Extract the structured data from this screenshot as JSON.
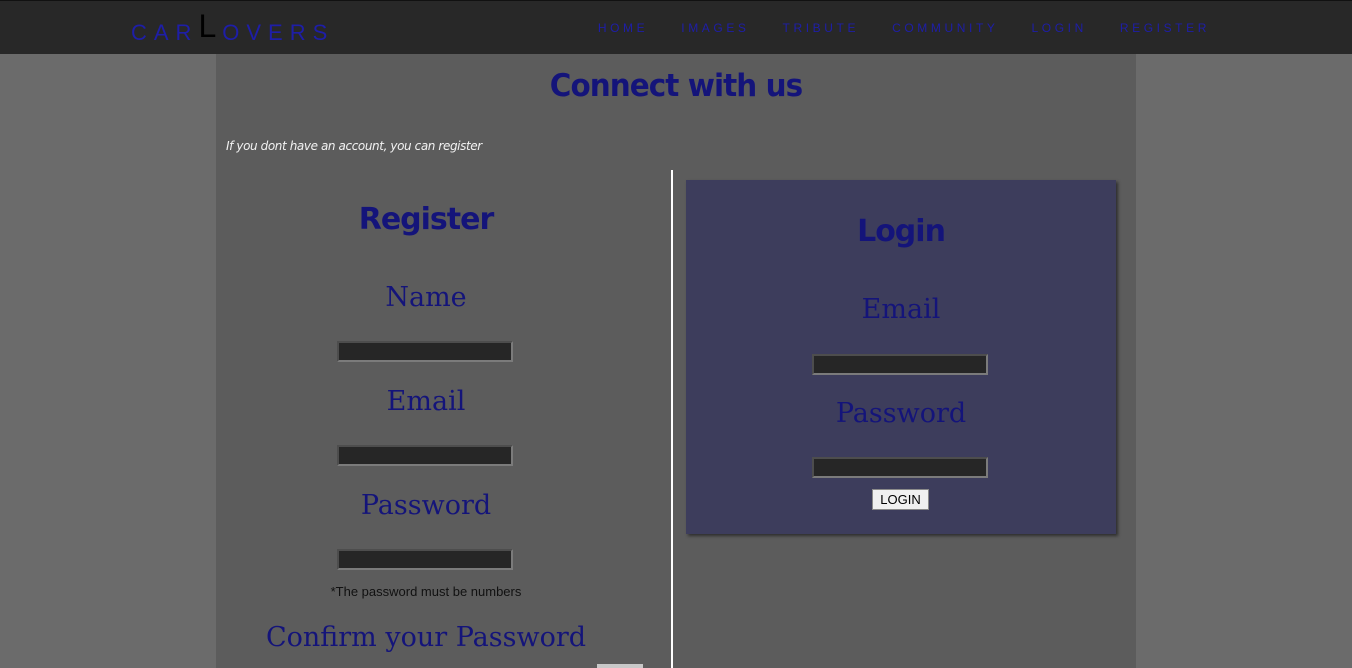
{
  "header": {
    "brand_prefix": "CAR",
    "brand_big": "L",
    "brand_suffix": "OVERS",
    "nav": [
      "HOME",
      "IMAGES",
      "TRIBUTE",
      "COMMUNITY",
      "LOGIN",
      "REGISTER"
    ]
  },
  "page": {
    "title": "Connect with us",
    "intro": "If you dont have an account, you can register"
  },
  "register": {
    "title": "Register",
    "name_label": "Name",
    "email_label": "Email",
    "password_label": "Password",
    "password_note": "*The password must be numbers",
    "confirm_label": "Confirm your Password",
    "name_value": "",
    "email_value": "",
    "password_value": ""
  },
  "login": {
    "title": "Login",
    "email_label": "Email",
    "password_label": "Password",
    "button_label": "LOGIN",
    "email_value": "",
    "password_value": ""
  },
  "colors": {
    "accent": "#14147a",
    "nav_text": "#1e1ea8",
    "navbar_bg": "#282828",
    "content_bg": "#5c5c5c",
    "login_panel_bg": "#3d3d5c",
    "page_bg": "#6b6b6b"
  }
}
